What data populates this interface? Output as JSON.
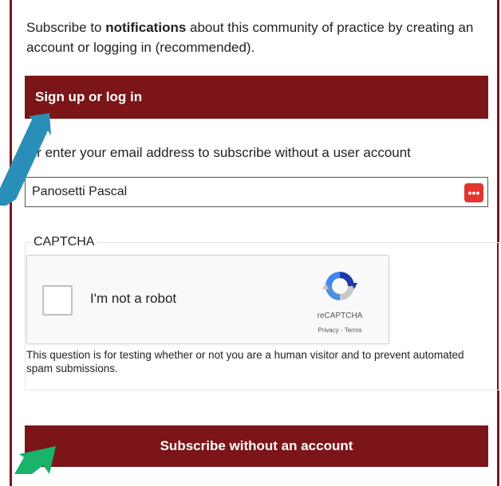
{
  "intro": {
    "prefix": "Subscribe to ",
    "bold": "notifications",
    "suffix": " about this community of practice by creating an account or logging in (recommended)."
  },
  "login_button": {
    "label": "Sign up or log in"
  },
  "email": {
    "label": "Or enter your email address to subscribe without a user account",
    "value": "Panosetti Pascal",
    "password_icon": "password-manager-icon"
  },
  "captcha": {
    "legend": "CAPTCHA",
    "checkbox_label": "I'm not a robot",
    "brand": "reCAPTCHA",
    "links": "Privacy - Terms",
    "help": "This question is for testing whether or not you are a human visitor and to prevent automated spam submissions."
  },
  "subscribe_button": {
    "label": "Subscribe without an account"
  },
  "colors": {
    "brand": "#7b1518",
    "arrow_blue": "#2a8fb8",
    "arrow_green": "#19b36b"
  }
}
